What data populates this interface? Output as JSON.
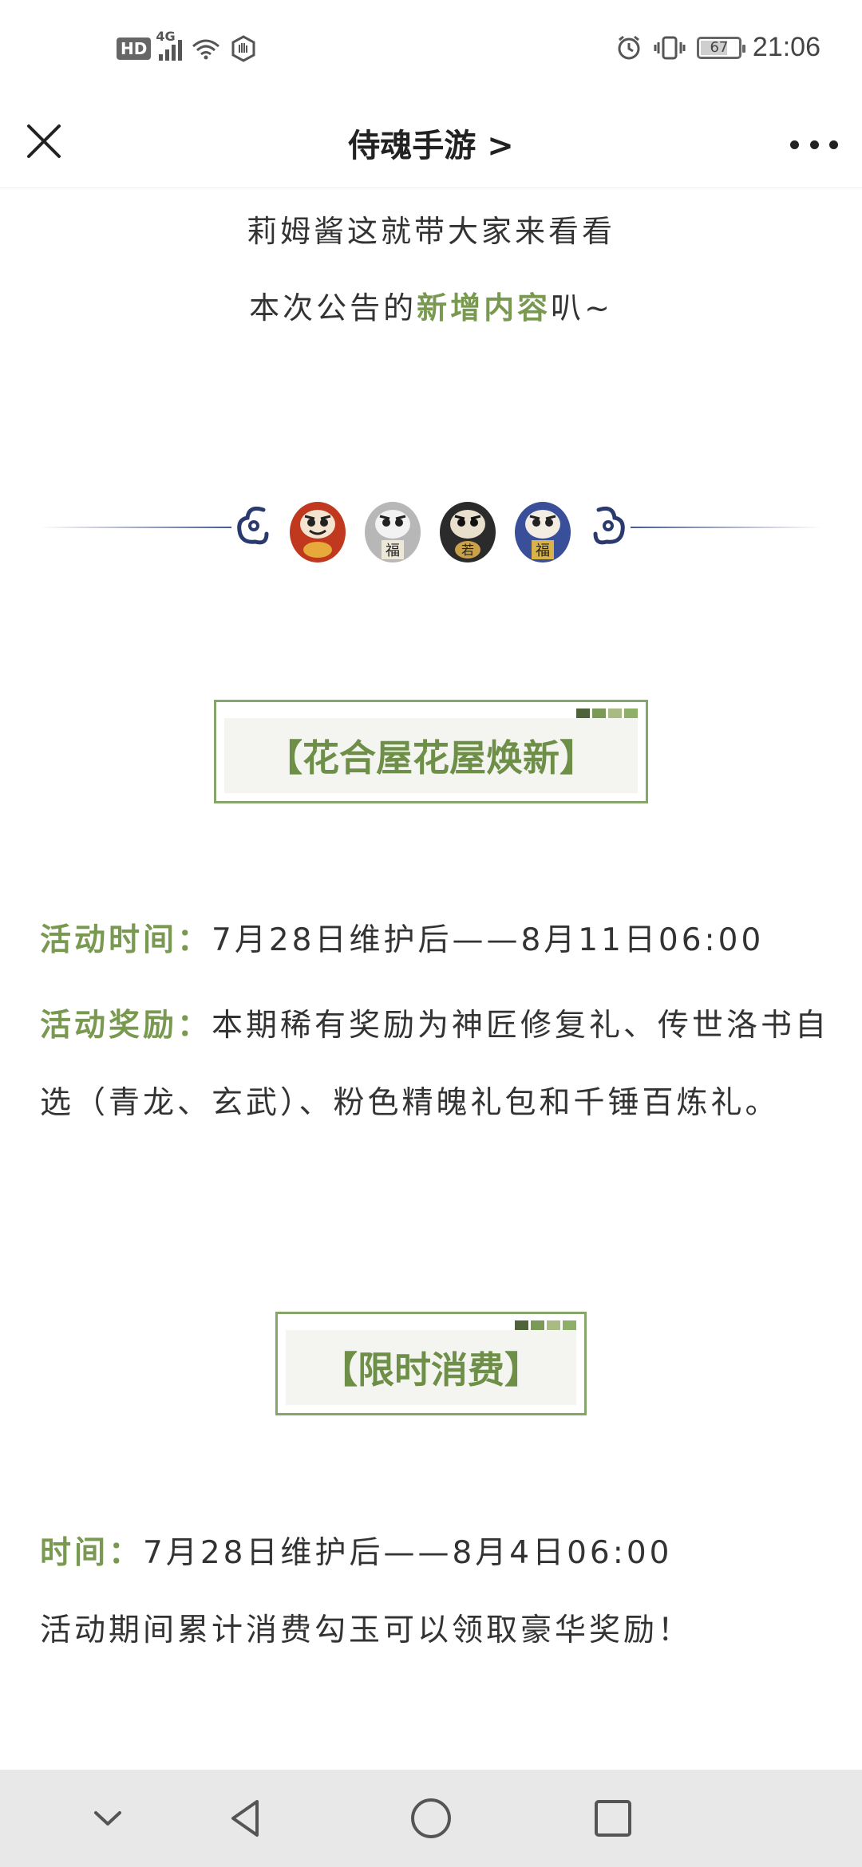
{
  "status_bar": {
    "hd_label": "HD",
    "network_label": "4G",
    "battery_level": "67",
    "time": "21:06",
    "icons": [
      "hd-icon",
      "signal-icon",
      "wifi-icon",
      "hand-icon",
      "alarm-icon",
      "vibrate-icon",
      "battery-icon"
    ]
  },
  "header": {
    "title": "侍魂手游 >"
  },
  "article": {
    "intro_line1": "莉姆酱这就带大家来看看",
    "intro_line2_prefix": "本次公告的",
    "intro_line2_highlight": "新增内容",
    "intro_line2_suffix": "叭~",
    "daruma_labels": [
      "福",
      "若",
      "福"
    ],
    "section1": {
      "title": "【花合屋花屋焕新】",
      "time_label": "活动时间：",
      "time_value": "7月28日维护后——8月11日06:00",
      "reward_label": "活动奖励：",
      "reward_value": "本期稀有奖励为神匠修复礼、传世洛书自选（青龙、玄武）、粉色精魄礼包和千锤百炼礼。"
    },
    "section2": {
      "title": "【限时消费】",
      "time_label": "时间：",
      "time_value": "7月28日维护后——8月4日06:00",
      "desc": "活动期间累计消费勾玉可以领取豪华奖励！"
    }
  },
  "nav_bar": {
    "buttons": [
      "chevron-down-icon",
      "back-icon",
      "home-icon",
      "recents-icon"
    ]
  },
  "colors": {
    "accent_green": "#78994f",
    "box_border": "#85a66a",
    "box_fill": "#f4f5f0",
    "divider_blue": "#4a5a8e"
  }
}
